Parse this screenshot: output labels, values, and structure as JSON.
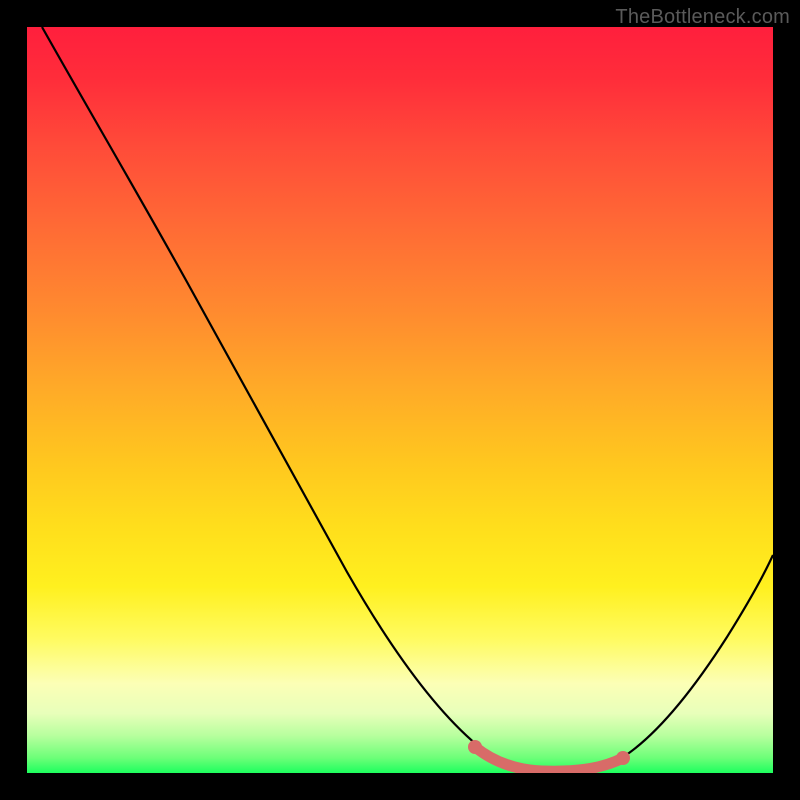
{
  "watermark": "TheBottleneck.com",
  "chart_data": {
    "type": "line",
    "title": "",
    "xlabel": "",
    "ylabel": "",
    "xlim": [
      0,
      100
    ],
    "ylim": [
      0,
      100
    ],
    "grid": false,
    "legend": false,
    "series": [
      {
        "name": "curve",
        "x": [
          2,
          10,
          20,
          30,
          40,
          50,
          58,
          62,
          66,
          70,
          74,
          78,
          82,
          86,
          90,
          94,
          98,
          100
        ],
        "y": [
          100,
          87,
          72,
          57,
          42,
          27,
          15,
          9,
          4,
          1,
          0,
          0,
          1,
          4,
          10,
          18,
          28,
          33
        ]
      }
    ],
    "highlight_band": {
      "name": "bottom-plateau",
      "x": [
        66,
        84
      ],
      "y": [
        1,
        1
      ]
    },
    "colors": {
      "curve": "#000000",
      "highlight": "#d86b68",
      "gradient_top": "#ff1f3d",
      "gradient_bottom": "#1dff5e"
    }
  }
}
